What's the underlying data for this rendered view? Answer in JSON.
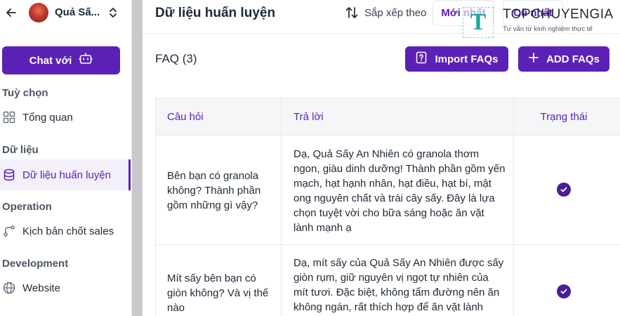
{
  "sidebar": {
    "workspace_name": "Quả Sấ...",
    "chat_button": "Chat với",
    "sections": [
      {
        "label": "Tuỳ chọn",
        "items": [
          {
            "label": "Tổng quan",
            "icon": "grid-icon"
          }
        ]
      },
      {
        "label": "Dữ liệu",
        "items": [
          {
            "label": "Dữ liệu huấn luyện",
            "icon": "database-icon",
            "active": true
          }
        ]
      },
      {
        "label": "Operation",
        "items": [
          {
            "label": "Kịch bản chốt sales",
            "icon": "flow-icon"
          }
        ]
      },
      {
        "label": "Development",
        "items": [
          {
            "label": "Website",
            "icon": "globe-icon"
          }
        ]
      }
    ]
  },
  "header": {
    "title": "Dữ liệu huấn luyện",
    "sort_label": "Sắp xếp theo",
    "sort_options": [
      "Mới nhất",
      "Cũ nhất"
    ]
  },
  "faq": {
    "heading": "FAQ (3)",
    "import_button": "Import FAQs",
    "add_button": "ADD FAQs"
  },
  "table": {
    "columns": [
      "Câu hỏi",
      "Trả lời",
      "Trạng thái"
    ],
    "rows": [
      {
        "question": "Bên bạn có granola không? Thành phần gồm những gì vậy?",
        "answer": "Dạ, Quả Sấy An Nhiên có granola thơm ngon, giàu dinh dưỡng! Thành phần gồm yến mạch, hạt hạnh nhân, hạt điều, hạt bí, mật ong nguyên chất và trái cây sấy. Đây là lựa chọn tuyệt vời cho bữa sáng hoặc ăn vặt lành mạnh ạ",
        "status": "active"
      },
      {
        "question": "Mít sấy bên bạn có giòn không? Và vị thế nào",
        "answer": "Dạ, mít sấy của Quả Sấy An Nhiên được sấy giòn rụm, giữ nguyên vị ngọt tự nhiên của mít tươi. Đặc biệt, không tẩm đường nên ăn không ngán, rất thích hợp để ăn vặt lành",
        "status": "active"
      }
    ]
  },
  "watermark": {
    "logo_letter": "T",
    "name": "TOPCHUYENGIA",
    "tagline": "Tư vấn từ kinh nghiệm thực tế"
  },
  "colors": {
    "accent": "#5b21b6",
    "check": "#4c1d95",
    "header_bg": "#f5f6f8",
    "active_nav_bg": "#f3f0fa",
    "watermark_teal": "#18a999"
  }
}
